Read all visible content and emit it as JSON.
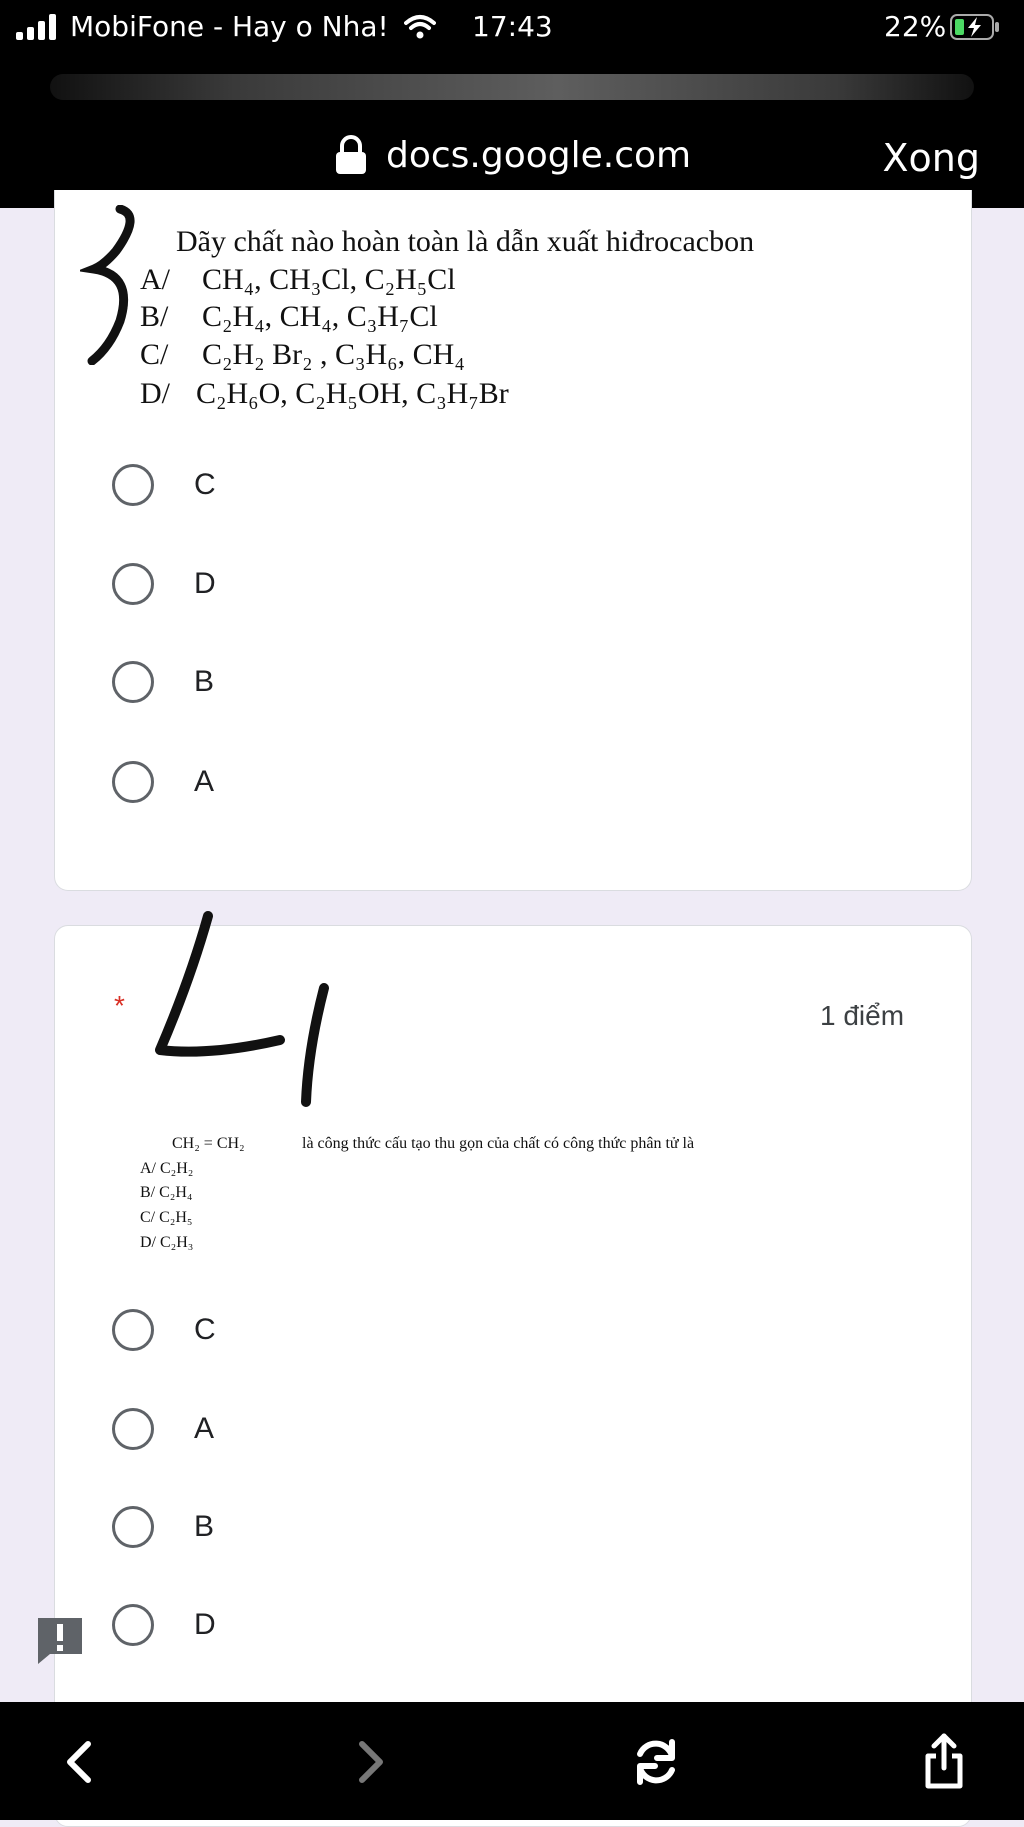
{
  "status": {
    "carrier": "MobiFone - Hay o Nha!",
    "time": "17:43",
    "battery": "22%"
  },
  "browser": {
    "url": "docs.google.com",
    "done_label": "Xong"
  },
  "question3": {
    "text": "Dãy chất nào hoàn toàn là dẫn xuất hiđrocacbon",
    "image_options": [
      {
        "label": "A/",
        "value": "CH₄, CH₃Cl, C₂H₅Cl"
      },
      {
        "label": "B/",
        "value": "C₂H₄, CH₄, C₃H₇Cl"
      },
      {
        "label": "C/",
        "value": "C₂H₂ Br₂ , C₃H₆, CH₄"
      },
      {
        "label": "D/",
        "value": "C₂H₆O, C₂H₅OH, C₃H₇Br"
      }
    ],
    "choices": [
      "C",
      "D",
      "B",
      "A"
    ]
  },
  "question4": {
    "required_mark": "*",
    "points": "1 điểm",
    "text_formula": "CH₂ = CH₂",
    "text": "là công thức cấu tạo thu gọn của chất có công thức phân tử là",
    "image_options": [
      {
        "label": "A/",
        "value": "C₂H₂"
      },
      {
        "label": "B/",
        "value": "C₂H₄"
      },
      {
        "label": "C/",
        "value": "C₂H₅"
      },
      {
        "label": "D/",
        "value": "C₂H₃"
      }
    ],
    "choices": [
      "C",
      "A",
      "B",
      "D"
    ]
  },
  "icons": {
    "signal": "signal-icon",
    "wifi": "wifi-icon",
    "battery": "battery-charging-icon",
    "lock": "lock-icon",
    "feedback": "feedback-icon",
    "back": "chevron-left-icon",
    "forward": "chevron-right-icon",
    "reload": "reload-icon",
    "share": "share-icon"
  }
}
